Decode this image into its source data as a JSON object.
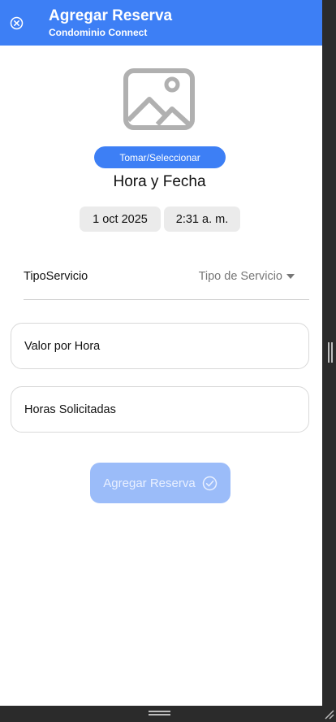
{
  "header": {
    "title": "Agregar Reserva",
    "subtitle": "Condominio Connect",
    "close_icon": "close-circle-icon",
    "color": "#3d7ff5"
  },
  "media": {
    "placeholder_icon": "image-icon",
    "pick_label": "Tomar/Seleccionar"
  },
  "datetime": {
    "title": "Hora y Fecha",
    "date": "1 oct 2025",
    "time": "2:31 a. m."
  },
  "service": {
    "label": "TipoServicio",
    "placeholder": "Tipo de Servicio"
  },
  "fields": {
    "hourly_rate": "Valor por Hora",
    "requested_hours": "Horas Solicitadas"
  },
  "submit": {
    "label": "Agregar Reserva",
    "icon": "check-circle-icon",
    "color": "#9bbcf9"
  }
}
